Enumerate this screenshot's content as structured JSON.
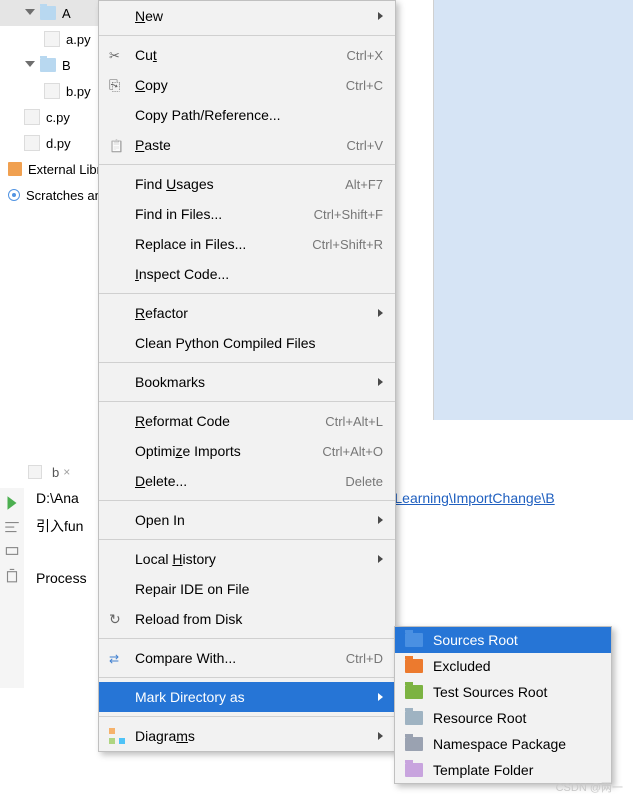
{
  "tree": {
    "folderA": "A",
    "fileA": "a.py",
    "folderB": "B",
    "fileB": "b.py",
    "fileC": "c.py",
    "fileD": "d.py",
    "externalLibs": "External Libraries",
    "scratches": "Scratches and Consoles"
  },
  "editorTab": {
    "name": "b",
    "close": "×"
  },
  "console": {
    "pathPrefix": "D:\\Ana",
    "pathLink": "_Learning\\ImportChange\\B",
    "inputLabel": "引入fun",
    "process": "Process"
  },
  "menu": {
    "new": "New",
    "cut": "Cut",
    "cut_sc": "Ctrl+X",
    "copy": "Copy",
    "copy_sc": "Ctrl+C",
    "copyPath": "Copy Path/Reference...",
    "paste": "Paste",
    "paste_sc": "Ctrl+V",
    "findUsages": "Find Usages",
    "findUsages_sc": "Alt+F7",
    "findInFiles": "Find in Files...",
    "findInFiles_sc": "Ctrl+Shift+F",
    "replaceInFiles": "Replace in Files...",
    "replaceInFiles_sc": "Ctrl+Shift+R",
    "inspectCode": "Inspect Code...",
    "refactor": "Refactor",
    "cleanPy": "Clean Python Compiled Files",
    "bookmarks": "Bookmarks",
    "reformat": "Reformat Code",
    "reformat_sc": "Ctrl+Alt+L",
    "optimizeImports": "Optimize Imports",
    "optimizeImports_sc": "Ctrl+Alt+O",
    "delete": "Delete...",
    "delete_sc": "Delete",
    "openIn": "Open In",
    "localHistory": "Local History",
    "repairIde": "Repair IDE on File",
    "reload": "Reload from Disk",
    "compareWith": "Compare With...",
    "compareWith_sc": "Ctrl+D",
    "markDirAs": "Mark Directory as",
    "diagrams": "Diagrams"
  },
  "submenu": {
    "sourcesRoot": "Sources Root",
    "excluded": "Excluded",
    "testSources": "Test Sources Root",
    "resourceRoot": "Resource Root",
    "namespacePkg": "Namespace Package",
    "templateFolder": "Template Folder"
  },
  "watermark": "CSDN @两一"
}
